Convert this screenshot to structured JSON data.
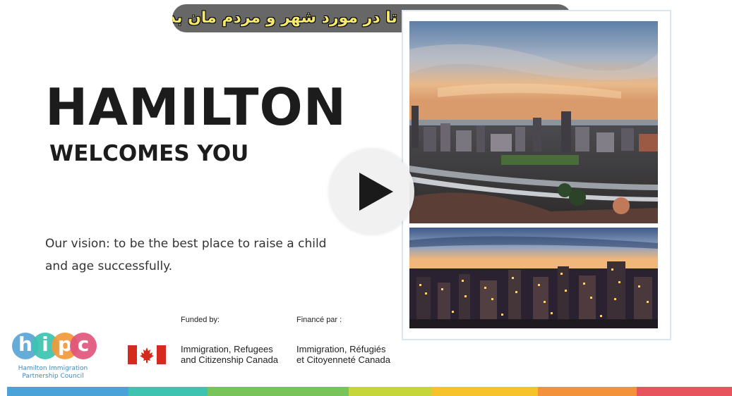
{
  "subtitle": "لطفا مدتی با ما باشید تا در مورد شهر و مردم مان بدانید",
  "title": "HAMILTON",
  "subtitle_en": "WELCOMES YOU",
  "vision_line1": "Our vision: to be the best place to raise a child",
  "vision_line2": "and age successfully.",
  "funding": {
    "funded_by": "Funded by:",
    "finance_par": "Financé par :",
    "ircc_en_line1": "Immigration, Refugees",
    "ircc_en_line2": "and Citizenship Canada",
    "ircc_fr_line1": "Immigration, Réfugiés",
    "ircc_fr_line2": "et Citoyenneté Canada"
  },
  "hipc": {
    "letters": [
      "h",
      "i",
      "p",
      "c"
    ],
    "letter_colors": [
      "#5aa6d6",
      "#3cc3b0",
      "#f29a3a",
      "#e0567c"
    ],
    "caption_line1": "Hamilton Immigration",
    "caption_line2": "Partnership Council"
  },
  "icons": {
    "play": "play-icon",
    "flag": "canada-flag-icon"
  },
  "strip_colors": [
    "#4aa3d8",
    "#3fc3b1",
    "#78c35a",
    "#c6d63a",
    "#f6c32c",
    "#f3923a",
    "#e8545e"
  ]
}
